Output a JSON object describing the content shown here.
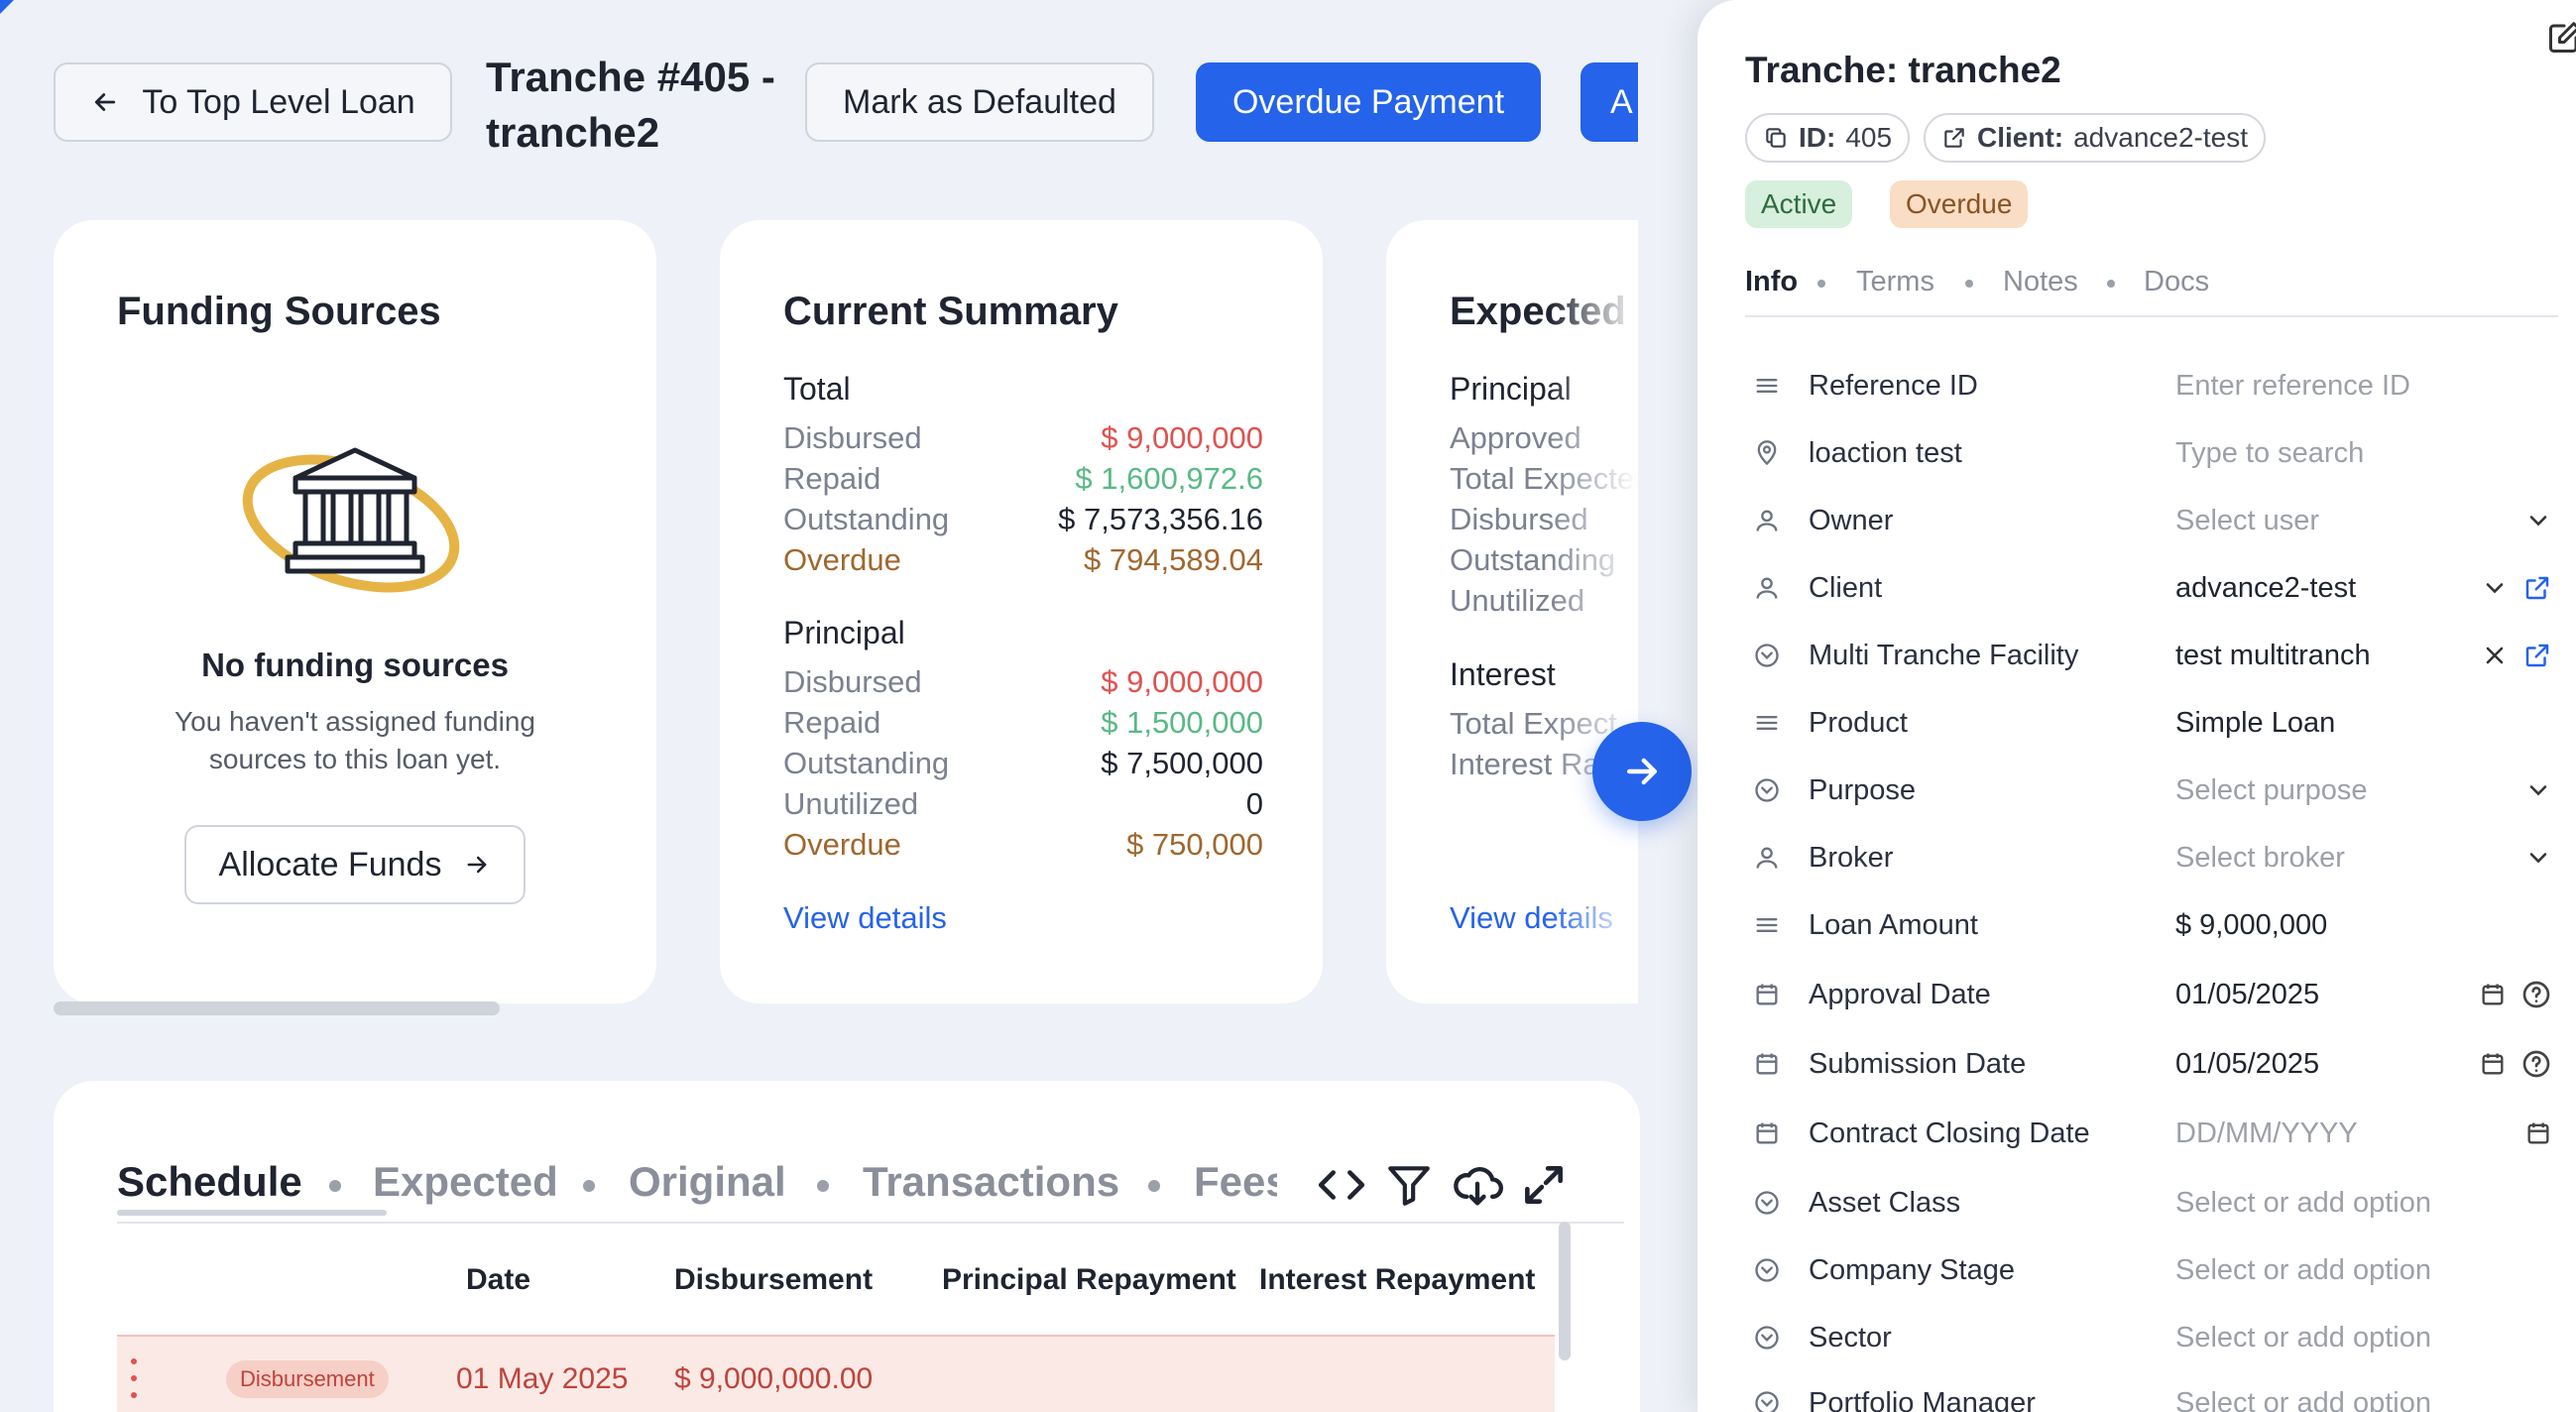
{
  "header": {
    "back_label": "To Top Level Loan",
    "title_line1": "Tranche #405 -",
    "title_line2": "tranche2",
    "mark_defaulted": "Mark as Defaulted",
    "overdue_payment": "Overdue Payment",
    "truncated_btn": "A"
  },
  "funding": {
    "title": "Funding Sources",
    "empty_title": "No funding sources",
    "empty_line1": "You haven't assigned funding",
    "empty_line2": "sources to this loan yet.",
    "allocate": "Allocate Funds"
  },
  "summary": {
    "title": "Current Summary",
    "total_heading": "Total",
    "total": [
      {
        "label": "Disbursed",
        "value": "$ 9,000,000"
      },
      {
        "label": "Repaid",
        "value": "$ 1,600,972.6"
      },
      {
        "label": "Outstanding",
        "value": "$ 7,573,356.16"
      },
      {
        "label": "Overdue",
        "value": "$ 794,589.04"
      }
    ],
    "principal_heading": "Principal",
    "principal": [
      {
        "label": "Disbursed",
        "value": "$ 9,000,000"
      },
      {
        "label": "Repaid",
        "value": "$ 1,500,000"
      },
      {
        "label": "Outstanding",
        "value": "$ 7,500,000"
      },
      {
        "label": "Unutilized",
        "value": "0"
      },
      {
        "label": "Overdue",
        "value": "$ 750,000"
      }
    ],
    "view_details": "View details"
  },
  "expected": {
    "title": "Expected",
    "principal_heading": "Principal",
    "principal_labels": [
      "Approved",
      "Total Expecte",
      "Disbursed",
      "Outstanding",
      "Unutilized"
    ],
    "interest_heading": "Interest",
    "interest_labels": [
      "Total Expect",
      "Interest Ra"
    ],
    "view_details": "View details"
  },
  "schedule": {
    "tabs": [
      "Schedule",
      "Expected",
      "Original",
      "Transactions",
      "Fees"
    ],
    "columns": [
      "Date",
      "Disbursement",
      "Principal Repayment",
      "Interest Repayment"
    ],
    "rows": [
      {
        "type": "Disbursement",
        "date": "01 May 2025",
        "disbursement": "$ 9,000,000.00"
      }
    ]
  },
  "panel": {
    "title": "Tranche: tranche2",
    "id_label": "ID:",
    "id_value": "405",
    "client_label": "Client:",
    "client_value": "advance2-test",
    "status_active": "Active",
    "status_overdue": "Overdue",
    "tabs": [
      "Info",
      "Terms",
      "Notes",
      "Docs"
    ],
    "fields": [
      {
        "label": "Reference ID",
        "value": "Enter reference ID"
      },
      {
        "label": "loaction test",
        "value": "Type to search"
      },
      {
        "label": "Owner",
        "value": "Select user"
      },
      {
        "label": "Client",
        "value": "advance2-test"
      },
      {
        "label": "Multi Tranche Facility",
        "value": "test multitranch"
      },
      {
        "label": "Product",
        "value": "Simple Loan"
      },
      {
        "label": "Purpose",
        "value": "Select purpose"
      },
      {
        "label": "Broker",
        "value": "Select broker"
      },
      {
        "label": "Loan Amount",
        "value": "$ 9,000,000"
      },
      {
        "label": "Approval Date",
        "value": "01/05/2025"
      },
      {
        "label": "Submission Date",
        "value": "01/05/2025"
      },
      {
        "label": "Contract Closing Date",
        "value": "DD/MM/YYYY"
      },
      {
        "label": "Asset Class",
        "value": "Select or add option"
      },
      {
        "label": "Company Stage",
        "value": "Select or add option"
      },
      {
        "label": "Sector",
        "value": "Select or add option"
      },
      {
        "label": "Portfolio Manager",
        "value": "Select or add option"
      }
    ]
  },
  "colors": {
    "primary": "#2563eb",
    "red": "#e0524f",
    "green": "#58b985",
    "brown": "#a0672e",
    "active_bg": "#d7efdd",
    "overdue_bg": "#f9ddc4",
    "bank_ring": "#e6b345"
  }
}
